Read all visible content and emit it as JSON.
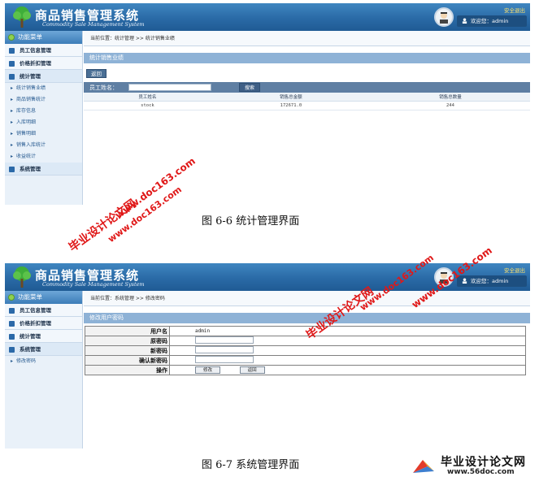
{
  "app": {
    "title": "商品销售管理系统",
    "subtitle": "Commodity Sale Management System",
    "safe_exit": "安全退出",
    "welcome": "欢迎您：admin"
  },
  "sidebar": {
    "header": "功能菜单",
    "items": [
      "员工信息管理",
      "价格折扣管理",
      "统计管理"
    ],
    "stats_sub": [
      "统计销售业绩",
      "商品销售统计",
      "库存信息",
      "入库明细",
      "销售明细",
      "销售入库统计",
      "收益统计"
    ],
    "system": "系统管理",
    "system_sub": [
      "修改密码"
    ]
  },
  "screen1": {
    "breadcrumb": "当前位置：统计管理 >> 统计销售业绩",
    "panel_title": "统计销售业绩",
    "back_button": "返回",
    "search_label": "员工姓名：",
    "search_button": "搜索",
    "columns": [
      "员工姓名",
      "销售总金额",
      "销售总数量"
    ],
    "rows": [
      [
        "stock",
        "172671.0",
        "244"
      ]
    ]
  },
  "screen2": {
    "breadcrumb": "当前位置：系统管理 >> 修改密码",
    "panel_title": "修改用户密码",
    "fields": {
      "username_label": "用户名",
      "username_value": "admin",
      "old_pwd_label": "原密码",
      "new_pwd_label": "新密码",
      "confirm_pwd_label": "确认新密码",
      "op_label": "操作"
    },
    "modify_button": "修改",
    "return_button": "返回"
  },
  "captions": {
    "fig1": "图 6-6  统计管理界面",
    "fig2": "图 6-7  系统管理界面"
  },
  "watermarks": {
    "cn": "毕业设计论文网",
    "url": "www.doc163.com"
  },
  "footer": {
    "title": "毕业设计论文网",
    "url": "www.56doc.com"
  }
}
